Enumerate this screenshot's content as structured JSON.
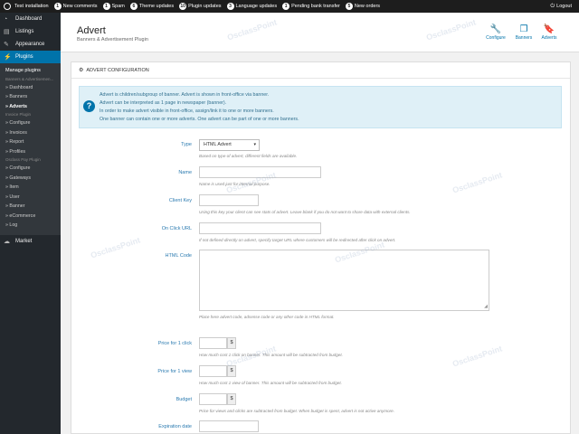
{
  "topbar": {
    "site": "Test installation",
    "items": [
      {
        "count": "1",
        "label": "New comments"
      },
      {
        "count": "1",
        "label": "Spam"
      },
      {
        "count": "6",
        "label": "Theme updates"
      },
      {
        "count": "10",
        "label": "Plugin updates"
      },
      {
        "count": "3",
        "label": "Language updates"
      },
      {
        "count": "1",
        "label": "Pending bank transfer"
      },
      {
        "count": "5",
        "label": "New orders"
      }
    ],
    "logout": "Logout"
  },
  "sidebar": {
    "dashboard": "Dashboard",
    "listings": "Listings",
    "appearance": "Appearance",
    "plugins": "Plugins",
    "manage_plugins": "Manage plugins",
    "group1": "Banners & Advertisemen...",
    "dashboard_sub": "» Dashboard",
    "banners_sub": "» Banners",
    "adverts_sub": "» Adverts",
    "group2": "Invoice Plugin",
    "configure1": "» Configure",
    "invoices": "» Invoices",
    "report": "» Report",
    "profiles": "» Profiles",
    "group3": "Osclass Pay Plugin",
    "configure2": "» Configure",
    "gateways": "» Gateways",
    "item": "» Item",
    "user": "» User",
    "banner": "» Banner",
    "ecommerce": "» eCommerce",
    "log": "» Log",
    "market": "Market"
  },
  "header": {
    "title": "Advert",
    "subtitle": "Banners & Advertisement Plugin",
    "configure": "Configure",
    "banners": "Banners",
    "adverts": "Adverts"
  },
  "panel": {
    "title": "ADVERT CONFIGURATION",
    "info": [
      "Advert is children/subgroup of banner. Advert is shown in front-office via banner.",
      "Advert can be interpreted as 1 page in newspaper (banner).",
      "In order to make advert visible in front-office, assign/link it to one or more banners.",
      "One banner can contain one or more adverts. One advert can be part of one or more banners."
    ],
    "fields": {
      "type_label": "Type",
      "type_value": "HTML Advert",
      "type_help": "Based on type of advert, different fields are available.",
      "name_label": "Name",
      "name_help": "Name is used just for internal purpose.",
      "client_label": "Client Key",
      "client_help": "Using this key your client can see stats of advert. Leave blank if you do not want to share data with external clients.",
      "url_label": "On Click URL",
      "url_help": "If not defined directly on advert, specify target URL where customers will be redirected after click on advert.",
      "html_label": "HTML Code",
      "html_help": "Place here advert code, adsense code or any other code in HTML format.",
      "click_label": "Price for 1 click",
      "click_help": "How much cost 1 click on banner. This amount will be subtracted from budget.",
      "view_label": "Price for 1 view",
      "view_help": "How much cost 1 view of banner. This amount will be subtracted from budget.",
      "budget_label": "Budget",
      "budget_help": "Price for views and clicks are subtracted from budget. When budget is spent, advert is not active anymore.",
      "expiration_label": "Expiration date",
      "currency": "$"
    }
  },
  "watermark": "OsclassPoint",
  "colors": {
    "accent": "#0073aa",
    "sidebar": "#23282d",
    "topbar": "#1d1d1d"
  }
}
